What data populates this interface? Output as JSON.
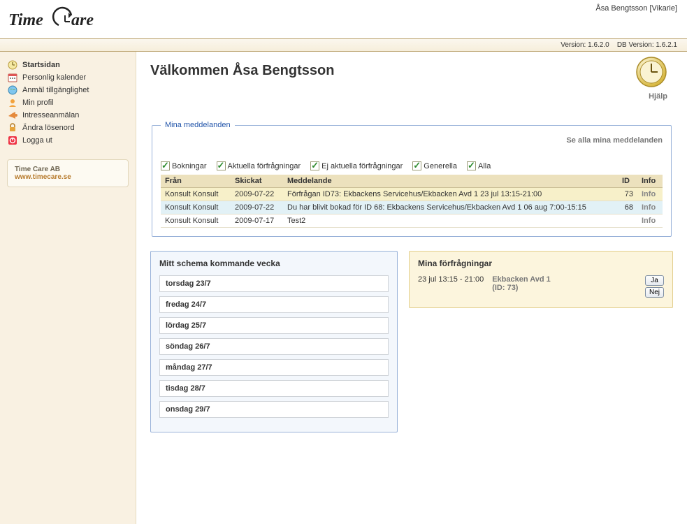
{
  "header": {
    "user_label": "Åsa Bengtsson [Vikarie]",
    "version_label": "Version: 1.6.2.0",
    "db_version_label": "DB Version: 1.6.2.1"
  },
  "sidebar": {
    "items": [
      {
        "label": "Startsidan"
      },
      {
        "label": "Personlig kalender"
      },
      {
        "label": "Anmäl tillgänglighet"
      },
      {
        "label": "Min profil"
      },
      {
        "label": "Intresseanmälan"
      },
      {
        "label": "Ändra lösenord"
      },
      {
        "label": "Logga ut"
      }
    ],
    "company": {
      "name": "Time Care AB",
      "link": "www.timecare.se"
    }
  },
  "main": {
    "title": "Välkommen Åsa Bengtsson",
    "help_label": "Hjälp"
  },
  "messages": {
    "legend": "Mina meddelanden",
    "see_all_label": "Se alla mina meddelanden",
    "filters": [
      "Bokningar",
      "Aktuella förfrågningar",
      "Ej aktuella förfrågningar",
      "Generella",
      "Alla"
    ],
    "columns": [
      "Från",
      "Skickat",
      "Meddelande",
      "ID",
      "Info"
    ],
    "rows": [
      {
        "row_class": "row-yellow",
        "from": "Konsult Konsult",
        "sent": "2009-07-22",
        "msg": "Förfrågan ID73: Ekbackens Servicehus/Ekbacken Avd 1 23 jul 13:15-21:00",
        "id": "73",
        "info": "Info"
      },
      {
        "row_class": "row-blue",
        "from": "Konsult Konsult",
        "sent": "2009-07-22",
        "msg": "Du har blivit bokad för ID 68: Ekbackens Servicehus/Ekbacken Avd 1 06 aug 7:00-15:15",
        "id": "68",
        "info": "Info"
      },
      {
        "row_class": "row-plain",
        "from": "Konsult Konsult",
        "sent": "2009-07-17",
        "msg": "Test2",
        "id": "",
        "info": "Info"
      }
    ]
  },
  "schedule": {
    "title": "Mitt schema kommande vecka",
    "days": [
      "torsdag 23/7",
      "fredag 24/7",
      "lördag 25/7",
      "söndag 26/7",
      "måndag 27/7",
      "tisdag 28/7",
      "onsdag 29/7"
    ]
  },
  "inquiries": {
    "title": "Mina förfrågningar",
    "items": [
      {
        "time": "23 jul 13:15 - 21:00",
        "location": "Ekbacken Avd 1",
        "idline": "(ID: 73)"
      }
    ],
    "buttons": {
      "yes": "Ja",
      "no": "Nej"
    }
  }
}
